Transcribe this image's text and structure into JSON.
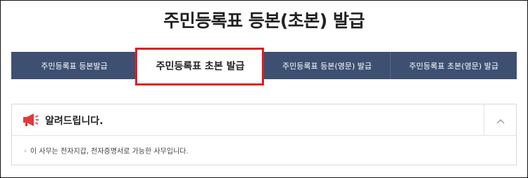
{
  "page": {
    "title": "주민등록표 등본(초본) 발급"
  },
  "tabs": [
    {
      "label": "주민등록표 등본발급",
      "active": false
    },
    {
      "label": "주민등록표 초본 발급",
      "active": true
    },
    {
      "label": "주민등록표 등본(영문) 발급",
      "active": false
    },
    {
      "label": "주민등록표 초본(영문) 발급",
      "active": false
    }
  ],
  "notice": {
    "title": "알려드립니다.",
    "bullet": "◦",
    "message": "이 사무는 전자지갑, 전자증명서로 가능한 사무입니다.",
    "icon": "megaphone-icon",
    "toggle_icon": "chevron-up-icon"
  },
  "colors": {
    "tab_bar": "#3d5072",
    "highlight": "#e31b23",
    "megaphone": "#e03a3a"
  }
}
